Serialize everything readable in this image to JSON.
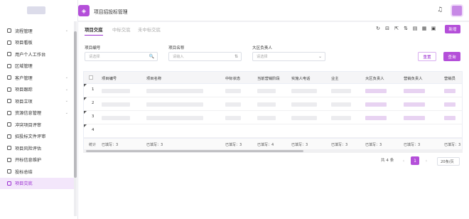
{
  "app": {
    "title": "项目招投标管理",
    "icon": "tag-icon"
  },
  "sidebar": {
    "items": [
      {
        "label": "流程管理",
        "icon": "list-icon",
        "arrow": "⌄"
      },
      {
        "label": "项目看板",
        "icon": "kanban-icon",
        "arrow": ""
      },
      {
        "label": "用户个人工作台",
        "icon": "desk-icon",
        "arrow": ""
      },
      {
        "label": "区域管理",
        "icon": "globe-icon",
        "arrow": ""
      },
      {
        "label": "客户管理",
        "icon": "user-icon",
        "arrow": "⌄"
      },
      {
        "label": "项目跟踪",
        "icon": "track-icon",
        "arrow": "⌄"
      },
      {
        "label": "项目立项",
        "icon": "star-icon",
        "arrow": "⌄"
      },
      {
        "label": "资源信息管理",
        "icon": "resource-icon",
        "arrow": "⌄"
      },
      {
        "label": "冲突项目评审",
        "icon": "conflict-icon",
        "arrow": ""
      },
      {
        "label": "招投标文件评审",
        "icon": "file-icon",
        "arrow": ""
      },
      {
        "label": "项目风险评估",
        "icon": "risk-icon",
        "arrow": ""
      },
      {
        "label": "开标信息维护",
        "icon": "edit-icon",
        "arrow": ""
      },
      {
        "label": "投标总结",
        "icon": "summary-icon",
        "arrow": ""
      },
      {
        "label": "项目交底",
        "icon": "handover-icon",
        "arrow": ""
      }
    ]
  },
  "tabs": [
    "项目交底",
    "中标交底",
    "未中标交底"
  ],
  "toolbar": {
    "icons": [
      "refresh-icon",
      "export-icon",
      "import-icon",
      "sort-icon",
      "filter-icon",
      "columns-icon",
      "print-icon"
    ],
    "add_label": "新增"
  },
  "filters": [
    {
      "label": "项目编号",
      "placeholder": "请选择",
      "icon": "🔍"
    },
    {
      "label": "项目名称",
      "placeholder": "请输入",
      "icon": "⇅"
    },
    {
      "label": "大区负责人",
      "placeholder": "请选择",
      "icon": "⌄"
    }
  ],
  "buttons": {
    "reset": "重置",
    "query": "查询"
  },
  "table": {
    "headers": [
      "",
      "项目编号",
      "项目名称",
      "中标状态",
      "当前营销阶段",
      "实施人电话",
      "业主",
      "大区负责人",
      "营销负责人",
      "营销员"
    ],
    "rows": [
      "1",
      "2",
      "3",
      "4"
    ],
    "summary_label": "统计",
    "summary": [
      "已填写：3",
      "已填写：3",
      "已填写：3",
      "已填写：4",
      "已填写：3",
      "已填写：3",
      "已填写：3",
      "已填写：3",
      "已填写：3"
    ]
  },
  "pagination": {
    "total": "共 4 条",
    "prev": "‹",
    "page": "1",
    "next": "›",
    "size": "20条/页"
  },
  "colors": {
    "accent": "#b44fd9",
    "active_bg": "#f3e6fb"
  }
}
